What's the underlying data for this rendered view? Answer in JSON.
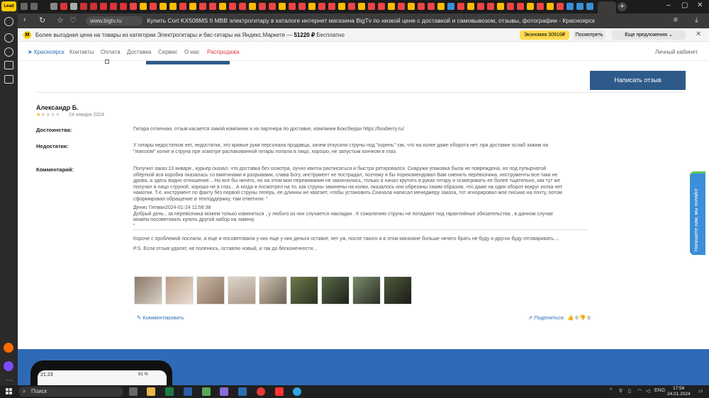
{
  "sidebar": {
    "logo_text": "Lead"
  },
  "browser": {
    "url": "www.bigtv.ru",
    "tab_title": "Купить Cort KX508MS II MBB электрогитару в каталоге интернет магазина BigTv по низкой цене с доставкой и самовывозом, отзывы, фотографии - Красноярск"
  },
  "banner": {
    "text_prefix": "Более выгодная цена на товары из категории Электрогитары и бас-гитары на Яндекс.Маркете —",
    "price": "51220 ₽",
    "free": "Бесплатно",
    "economy_label": "Экономия 30910₽",
    "view_label": "Посмотреть",
    "more_label": "Еще предложения ⌄"
  },
  "sitenav": {
    "city": "Красноярск",
    "items": [
      "Контакты",
      "Оплата",
      "Доставка",
      "Сервис",
      "О нас"
    ],
    "sale": "Распродажа",
    "account": "Личный кабинет"
  },
  "review": {
    "write_button": "Написать отзыв",
    "author": "Александр Б.",
    "rating": 1,
    "stars_total": 5,
    "date": "24 января 2024",
    "pros_label": "Достоинства:",
    "pros_text": "Гитара отличная, отзыв касается замой компании и их партнера по доставке, компании Боксберри https://boxberry.ru/",
    "cons_label": "Недостатки:",
    "cons_lines": [
      "У гитары недостатков нет, недостатки, это кривые руки персонала продавца, зачем откусили струны под \"корень\" так, что на колке даже оборота нет, при доставке ослаб зажим на",
      "\"покозом\" колке и струна при осмотре распакованной гитары попала в лицо, хорошо, не запустым кончком в глаз."
    ],
    "comment_label": "Комментарий:",
    "comment_lines": [
      "Получил заказ 13 января , курьер сказал, что доставка без осмотра, оучно квиток расписаться и быстра ретировался. Снаружи упаковка была не повреждена, но под пупырчатой",
      "обёрткой вся коробка оказалась со вмятинами и разрывами, слава Богу, инструмент не пострадал, поэтому я бы порекомендовал Вам сменить перевозчика, инструменты все-таки не",
      "дрова, а здесь видно отношение... Но все бы ничего, но на этом мои переживания не закончились, только я начал крутить в руках гитару и осматривать ее более тщательно, как тут же",
      "получил в лицо струной, хорошо не в глаз... А когда я посмотрел на то, как струны закинены на колки, оказалось они обрезаны таким образом, что даже на один оборот вокруг колка нет",
      "намотки. Т.е. инструмент по факту без первой струны теперь, ее длинны не хватает, чтобы установить.Сначала написал менеджеру заказа, тот игнорировал мое письмо на почту, потом",
      "сформировал обращение в техподдержку, там ответили: \""
    ],
    "reply_header": "Денис Гитман2024-01-24 11:56:38",
    "reply_lines": [
      "Добрый день , за перевозчика можем только извиниться , у любого из них случается накладки . К сожалению струны не попадают под гарантийные обязательства , в данном случае",
      "можем посоветовать купить другой набор на замену",
      "\""
    ],
    "after_lines": [
      "Короче с проблемой послали, а еще и посоветовали у них еще у них деньги оставит, нет уж, после такого я в этом магазине больше ничего брать не буду и других буду отговаривать...."
    ],
    "ps": "P.S. Если отзыв удалят, не поленюсь, оставлю новый, и так до бесконечности...",
    "comment_action": "Комментировать",
    "share_action": "Поделиться",
    "likes": "0",
    "dislikes": "0"
  },
  "feedback_tab": "Напишите нам, мы онлайн!",
  "footer_phone": {
    "time": "21:23",
    "battery": "91 %"
  },
  "taskbar": {
    "search_placeholder": "Поиск",
    "lang": "ENG",
    "time": "17:56",
    "date": "24.01.2024"
  },
  "colors": {
    "accent": "#2e5a8a",
    "link": "#2d6db5",
    "sale": "#e23c3c",
    "star": "#f4b400",
    "footer": "#2e6ab5"
  }
}
